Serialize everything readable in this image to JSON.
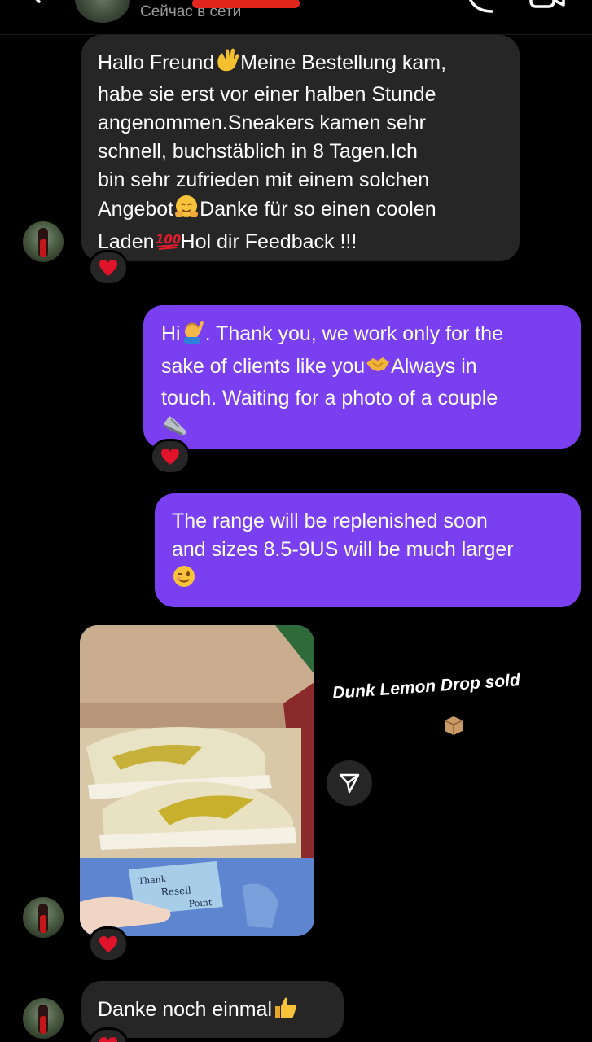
{
  "header": {
    "status": "Сейчас в сети"
  },
  "messages": {
    "m1": "Hallo Freund",
    "m1b": "Meine Bestellung kam, \nhabe sie erst vor einer halben Stunde\nangenommen.Sneakers kamen sehr\nschnell, buchstäblich in 8 Tagen.Ich\nbin sehr zufrieden mit einem solchen\nAngebot",
    "m1c": "Danke für so einen coolen",
    "m1d": "Laden",
    "m1e": "Hol dir Feedback !!!",
    "m2a": "Hi",
    "m2b": ". Thank you, we work only for the",
    "m2c": "sake of clients like you",
    "m2d": "Always in",
    "m2e": "touch. Waiting for a photo of a couple",
    "m3": "The range will be replenished soon\nand sizes 8.5-9US will be much larger",
    "m4": "Danke noch einmal"
  },
  "story": {
    "caption": "Dunk Lemon Drop sold",
    "note_line1": "Thank",
    "note_line2": "Resell",
    "note_line3": "Point"
  },
  "reactions": [
    "❤",
    "❤",
    "❤",
    "❤"
  ],
  "icons": {
    "back": "back-arrow-icon",
    "call": "phone-icon",
    "video": "video-camera-icon",
    "share": "send-icon",
    "heart": "heart-icon"
  },
  "colors": {
    "background": "#000000",
    "incoming_bubble": "#262626",
    "outgoing_bubble": "#7a3ff0",
    "heart": "#e0132b"
  }
}
